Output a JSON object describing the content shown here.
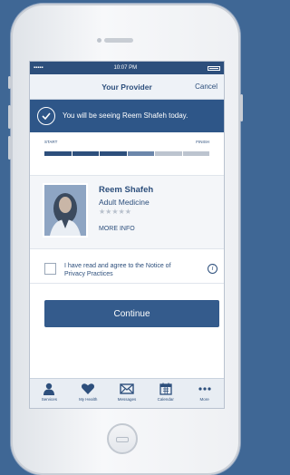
{
  "status_bar": {
    "signal": "▪▪▪▪▪",
    "time": "10:07 PM"
  },
  "nav": {
    "title": "Your Provider",
    "cancel": "Cancel"
  },
  "banner": {
    "text": "You will be seeing Reem Shafeh today."
  },
  "progress": {
    "start_label": "START",
    "finish_label": "FINISH",
    "steps_total": 6,
    "steps_done": 3
  },
  "provider": {
    "name": "Reem Shafeh",
    "specialty": "Adult Medicine",
    "rating_stars": "★★★★★",
    "rating": 0,
    "more_info": "MORE INFO"
  },
  "agreement": {
    "text": "I have read and agree to the Notice of Privacy Practices",
    "checked": false
  },
  "continue_label": "Continue",
  "tabs": [
    {
      "label": "Services",
      "icon": "person-icon"
    },
    {
      "label": "My Health",
      "icon": "heart-icon"
    },
    {
      "label": "Messages",
      "icon": "envelope-icon"
    },
    {
      "label": "Calendar",
      "icon": "calendar-icon"
    },
    {
      "label": "More",
      "icon": "more-icon"
    }
  ],
  "colors": {
    "brand": "#2d4f7c",
    "background": "#3f6795"
  }
}
